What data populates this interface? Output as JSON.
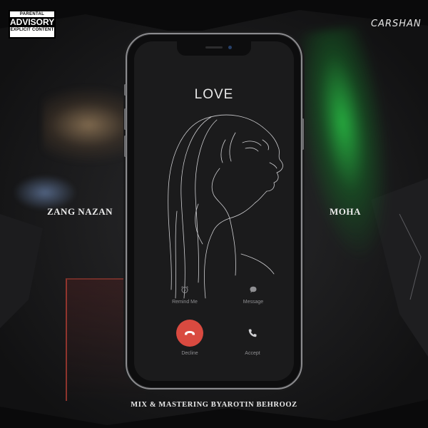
{
  "advisory": {
    "line1": "PARENTAL",
    "line2": "ADVISORY",
    "line3": "EXPLICIT CONTENT"
  },
  "brand": "CARSHAN",
  "titles": {
    "left": "ZANG NAZAN",
    "right": "MOHA"
  },
  "credits": "MIX & MASTERING BYAROTIN BEHROOZ",
  "phone": {
    "caller_name": "LOVE",
    "actions": {
      "remind_label": "Remind Me",
      "message_label": "Message",
      "decline_label": "Decline",
      "accept_label": "Accept"
    },
    "icons": {
      "remind": "alarm-clock-icon",
      "message": "chat-bubble-icon",
      "decline": "phone-hangup-icon",
      "accept": "phone-icon"
    }
  },
  "colors": {
    "decline_button": "#d94a40",
    "glow_green": "#28c846",
    "background": "#0b0b0c"
  }
}
